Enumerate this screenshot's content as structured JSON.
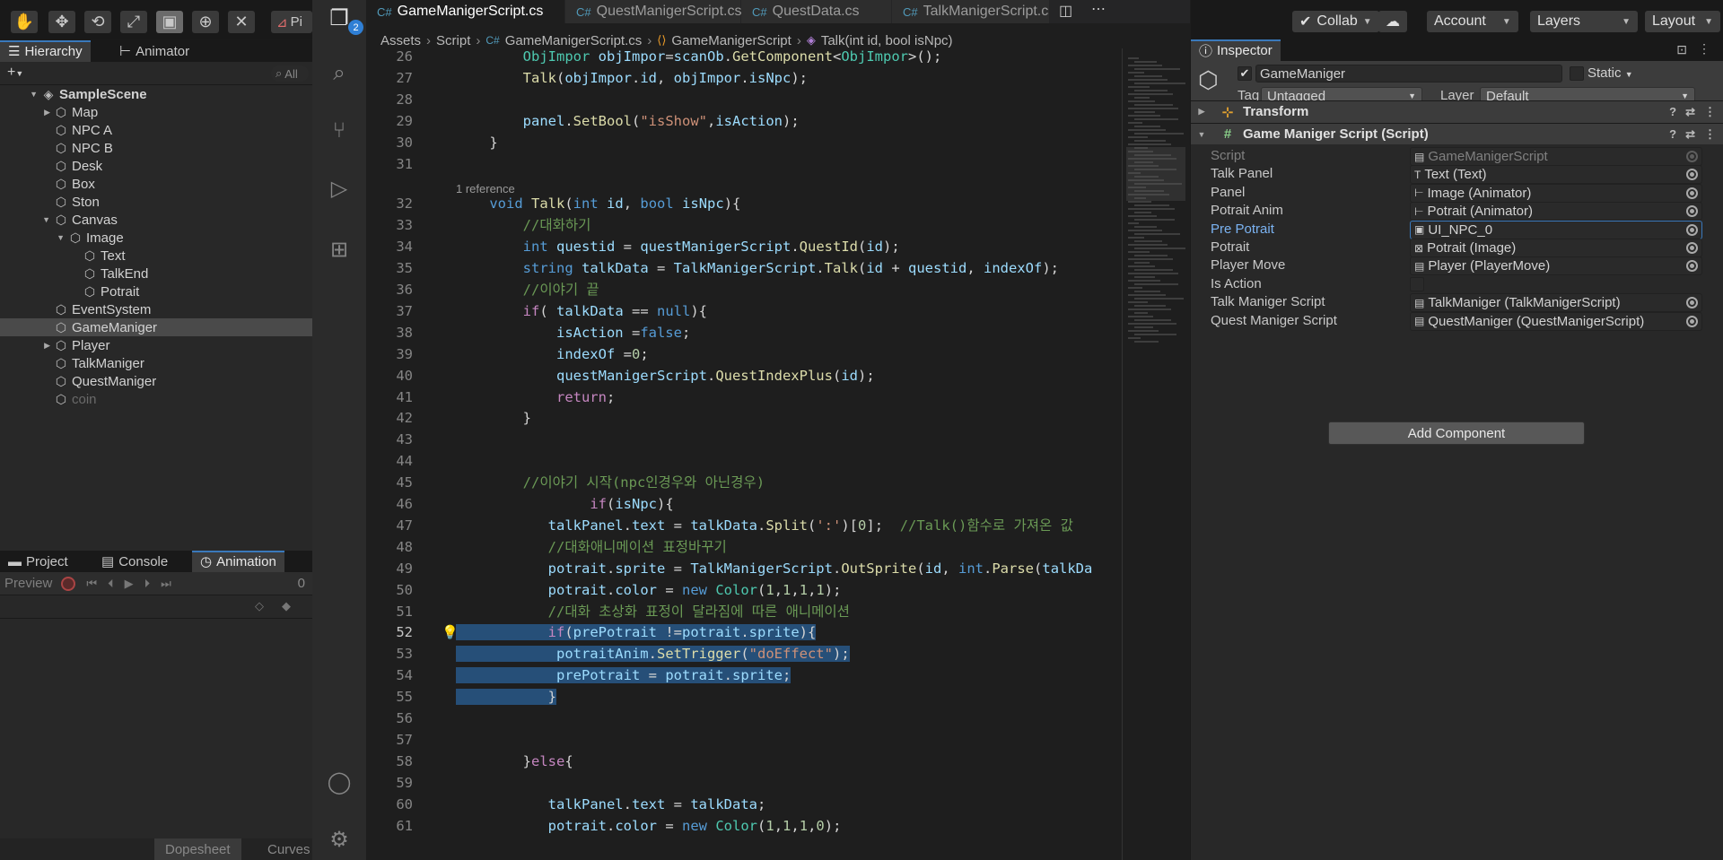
{
  "unity_toolbar": {
    "tools": [
      "hand-tool",
      "move-tool",
      "rotate-tool",
      "scale-tool",
      "rect-tool",
      "transform-tool",
      "custom-tool"
    ],
    "pivot_label": "Pi",
    "collab_label": "Collab",
    "account_label": "Account",
    "layers_label": "Layers",
    "layout_label": "Layout"
  },
  "hierarchy": {
    "tab_label": "Hierarchy",
    "animator_tab_label": "Animator",
    "search_placeholder": "All",
    "scene_name": "SampleScene",
    "items": [
      {
        "label": "Map",
        "indent": 1,
        "expandable": true
      },
      {
        "label": "NPC A",
        "indent": 1,
        "expandable": false
      },
      {
        "label": "NPC B",
        "indent": 1,
        "expandable": false
      },
      {
        "label": "Desk",
        "indent": 1,
        "expandable": false
      },
      {
        "label": "Box",
        "indent": 1,
        "expandable": false
      },
      {
        "label": "Ston",
        "indent": 1,
        "expandable": false
      },
      {
        "label": "Canvas",
        "indent": 1,
        "expandable": true
      },
      {
        "label": "Image",
        "indent": 2,
        "expandable": true
      },
      {
        "label": "Text",
        "indent": 3,
        "expandable": false
      },
      {
        "label": "TalkEnd",
        "indent": 3,
        "expandable": false
      },
      {
        "label": "Potrait",
        "indent": 3,
        "expandable": false
      },
      {
        "label": "EventSystem",
        "indent": 1,
        "expandable": false
      },
      {
        "label": "GameManiger",
        "indent": 1,
        "expandable": false
      },
      {
        "label": "Player",
        "indent": 1,
        "expandable": true
      },
      {
        "label": "TalkManiger",
        "indent": 1,
        "expandable": false
      },
      {
        "label": "QuestManiger",
        "indent": 1,
        "expandable": false
      },
      {
        "label": "coin",
        "indent": 1,
        "expandable": false
      }
    ]
  },
  "bottom_panel": {
    "tabs": [
      "Project",
      "Console",
      "Animation"
    ],
    "preview_label": "Preview",
    "frame_value": "0",
    "dopesheet_label": "Dopesheet",
    "curves_label": "Curves"
  },
  "vscode": {
    "explorer_badge": "2",
    "tabs": [
      "GameManigerScript.cs",
      "QuestManigerScript.cs",
      "QuestData.cs",
      "TalkManigerScript.cs"
    ],
    "breadcrumbs": [
      "Assets",
      "Script",
      "GameManigerScript.cs",
      "GameManigerScript",
      "Talk(int id, bool isNpc)"
    ],
    "code_lines": [
      {
        "n": "26",
        "html": "        <span class=\"ty\">ObjImpor</span> <span class=\"va\">objImpor</span>=<span class=\"va\">scanOb</span>.<span class=\"fn\">GetComponent</span>&lt;<span class=\"ty\">ObjImpor</span>&gt;();"
      },
      {
        "n": "27",
        "html": "        <span class=\"fn\">Talk</span>(<span class=\"va\">objImpor</span>.<span class=\"va\">id</span>, <span class=\"va\">objImpor</span>.<span class=\"va\">isNpc</span>);"
      },
      {
        "n": "28",
        "html": ""
      },
      {
        "n": "29",
        "html": "        <span class=\"va\">panel</span>.<span class=\"fn\">SetBool</span>(<span class=\"st\">\"isShow\"</span>,<span class=\"va\">isAction</span>);"
      },
      {
        "n": "30",
        "html": "    }"
      },
      {
        "n": "31",
        "html": ""
      },
      {
        "n": "32",
        "html": "    <span class=\"kw\">void</span> <span class=\"fn\">Talk</span>(<span class=\"kw\">int</span> <span class=\"va\">id</span>, <span class=\"kw\">bool</span> <span class=\"va\">isNpc</span>){"
      },
      {
        "n": "33",
        "html": "        <span class=\"cm\">//대화하기</span>"
      },
      {
        "n": "34",
        "html": "        <span class=\"kw\">int</span> <span class=\"va\">questid</span> = <span class=\"va\">questManigerScript</span>.<span class=\"fn\">QuestId</span>(<span class=\"va\">id</span>);"
      },
      {
        "n": "35",
        "html": "        <span class=\"kw\">string</span> <span class=\"va\">talkData</span> = <span class=\"va\">TalkManigerScript</span>.<span class=\"fn\">Talk</span>(<span class=\"va\">id</span> + <span class=\"va\">questid</span>, <span class=\"va\">indexOf</span>);"
      },
      {
        "n": "36",
        "html": "        <span class=\"cm\">//이야기 끝</span>"
      },
      {
        "n": "37",
        "html": "        <span class=\"ct\">if</span>( <span class=\"va\">talkData</span> == <span class=\"kw\">null</span>){"
      },
      {
        "n": "38",
        "html": "            <span class=\"va\">isAction</span> =<span class=\"kw\">false</span>;"
      },
      {
        "n": "39",
        "html": "            <span class=\"va\">indexOf</span> =<span class=\"nu\">0</span>;"
      },
      {
        "n": "40",
        "html": "            <span class=\"va\">questManigerScript</span>.<span class=\"fn\">QuestIndexPlus</span>(<span class=\"va\">id</span>);"
      },
      {
        "n": "41",
        "html": "            <span class=\"ct\">return</span>;"
      },
      {
        "n": "42",
        "html": "        }"
      },
      {
        "n": "43",
        "html": ""
      },
      {
        "n": "44",
        "html": ""
      },
      {
        "n": "45",
        "html": "        <span class=\"cm\">//이야기 시작(npc인경우와 아닌경우)</span>"
      },
      {
        "n": "46",
        "html": "                <span class=\"ct\">if</span>(<span class=\"va\">isNpc</span>){"
      },
      {
        "n": "47",
        "html": "           <span class=\"va\">talkPanel</span>.<span class=\"va\">text</span> = <span class=\"va\">talkData</span>.<span class=\"fn\">Split</span>(<span class=\"st\">':'</span>)[<span class=\"nu\">0</span>];  <span class=\"cm\">//Talk()함수로 가져온 값</span>"
      },
      {
        "n": "48",
        "html": "           <span class=\"cm\">//대화애니메이션 표정바꾸기</span>"
      },
      {
        "n": "49",
        "html": "           <span class=\"va\">potrait</span>.<span class=\"va\">sprite</span> = <span class=\"va\">TalkManigerScript</span>.<span class=\"fn\">OutSprite</span>(<span class=\"va\">id</span>, <span class=\"kw\">int</span>.<span class=\"fn\">Parse</span>(<span class=\"va\">talkDa</span>"
      },
      {
        "n": "50",
        "html": "           <span class=\"va\">potrait</span>.<span class=\"va\">color</span> = <span class=\"kw\">new</span> <span class=\"ty\">Color</span>(<span class=\"nu\">1</span>,<span class=\"nu\">1</span>,<span class=\"nu\">1</span>,<span class=\"nu\">1</span>);"
      },
      {
        "n": "51",
        "html": "           <span class=\"cm\">//대화 초상화 표정이 달라짐에 따른 애니메이션</span>"
      },
      {
        "n": "52",
        "html": "           <span class=\"ct\">if</span>(<span class=\"va\">prePotrait</span> !=<span class=\"va\">potrait</span>.<span class=\"va\">sprite</span>){"
      },
      {
        "n": "53",
        "html": "            <span class=\"va\">potraitAnim</span>.<span class=\"fn\">SetTrigger</span>(<span class=\"st\">\"doEffect\"</span>);"
      },
      {
        "n": "54",
        "html": "            <span class=\"va\">prePotrait</span> = <span class=\"va\">potrait</span>.<span class=\"va\">sprite</span>;"
      },
      {
        "n": "55",
        "html": "           }"
      },
      {
        "n": "56",
        "html": ""
      },
      {
        "n": "57",
        "html": ""
      },
      {
        "n": "58",
        "html": "        }<span class=\"ct\">else</span>{"
      },
      {
        "n": "59",
        "html": ""
      },
      {
        "n": "60",
        "html": "           <span class=\"va\">talkPanel</span>.<span class=\"va\">text</span> = <span class=\"va\">talkData</span>;"
      },
      {
        "n": "61",
        "html": "           <span class=\"va\">potrait</span>.<span class=\"va\">color</span> = <span class=\"kw\">new</span> <span class=\"ty\">Color</span>(<span class=\"nu\">1</span>,<span class=\"nu\">1</span>,<span class=\"nu\">1</span>,<span class=\"nu\">0</span>);"
      }
    ],
    "reference_label": "1 reference",
    "current_line": "52"
  },
  "inspector": {
    "tab_label": "Inspector",
    "object_name": "GameManiger",
    "static_label": "Static",
    "tag_label": "Tag",
    "tag_value": "Untagged",
    "layer_label": "Layer",
    "layer_value": "Default",
    "transform_label": "Transform",
    "component_label": "Game Maniger Script (Script)",
    "properties": [
      {
        "label": "Script",
        "value": "GameManigerScript",
        "icon": "script",
        "dim": true
      },
      {
        "label": "Talk Panel",
        "value": "Text (Text)",
        "icon": "text"
      },
      {
        "label": "Panel",
        "value": "Image (Animator)",
        "icon": "animator"
      },
      {
        "label": "Potrait Anim",
        "value": "Potrait (Animator)",
        "icon": "animator"
      },
      {
        "label": "Pre Potrait",
        "value": "UI_NPC_0",
        "icon": "sprite",
        "highlight": true
      },
      {
        "label": "Potrait",
        "value": "Potrait (Image)",
        "icon": "image"
      },
      {
        "label": "Player Move",
        "value": "Player (PlayerMove)",
        "icon": "script"
      },
      {
        "label": "Is Action",
        "value": "",
        "icon": "checkbox"
      },
      {
        "label": "Talk Maniger Script",
        "value": "TalkManiger (TalkManigerScript)",
        "icon": "script"
      },
      {
        "label": "Quest Maniger Script",
        "value": "QuestManiger (QuestManigerScript)",
        "icon": "script"
      }
    ],
    "add_component_label": "Add Component"
  }
}
